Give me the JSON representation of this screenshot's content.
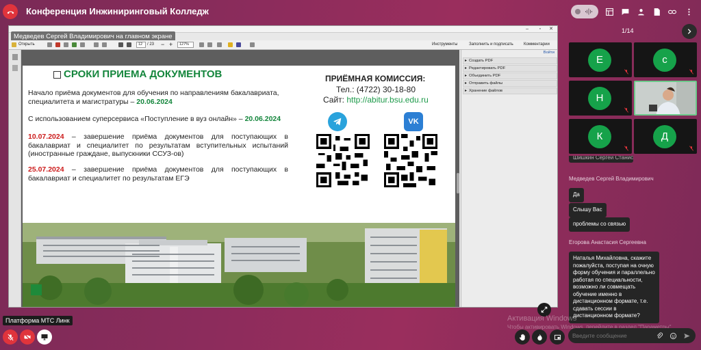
{
  "header": {
    "title": "Конференция Инжиниринговый Колледж",
    "icons": [
      "phone-hangup-icon",
      "noise-suppression-icon",
      "layout-icon",
      "chat-icon",
      "participants-icon",
      "file-icon",
      "link-icon",
      "more-icon"
    ]
  },
  "screen_share": {
    "presenter_label": "Медведев Сергей Владимирович на главном экране",
    "toolbar": {
      "open_label": "Открыть",
      "page_current": "12",
      "page_total": "/ 23",
      "zoom": "127%",
      "tools_label": "Инструменты",
      "sign_label": "Заполнить и подписать",
      "comment_label": "Комментарии"
    },
    "right_pane": {
      "login": "Войти",
      "items": [
        "Создать PDF",
        "Редактировать PDF",
        "Объединить PDF",
        "Отправить файлы",
        "Хранение файлов"
      ]
    },
    "slide": {
      "heading": "СРОКИ ПРИЕМА ДОКУМЕНТОВ",
      "p1_text": "Начало приёма документов для обучения по направлениям бакалавриата, специалитета и магистратуры – ",
      "p1_date": "20.06.2024",
      "p2_text": "С использованием суперсервиса «Поступление в вуз онлайн» – ",
      "p2_date": "20.06.2024",
      "p3_date": "10.07.2024",
      "p3_text": " – завершение приёма документов для поступающих в бакалавриат и специалитет по результатам вступительных испытаний (иностранные граждане, выпускники ССУЗ-ов)",
      "p4_date": "25.07.2024",
      "p4_text": " – завершение приёма документов для поступающих в бакалавриат и специалитет по результатам ЕГЭ",
      "commission_title": "ПРИЁМНАЯ КОМИССИЯ:",
      "commission_tel": "Тел.: (4722) 30-18-80",
      "commission_site_label": "Сайт: ",
      "commission_site": "http://abitur.bsu.edu.ru",
      "social": [
        "telegram-icon",
        "vk-icon"
      ]
    }
  },
  "participants": {
    "page": "1/14",
    "tiles": [
      {
        "initial": "Е",
        "muted": true
      },
      {
        "initial": "с",
        "muted": true
      },
      {
        "initial": "Н",
        "muted": true
      },
      {
        "initial": "",
        "muted": false,
        "video": true
      },
      {
        "initial": "К",
        "muted": true
      },
      {
        "initial": "Д",
        "muted": true
      }
    ]
  },
  "chat": {
    "partial_name": "Шишкин Сергей Станиславович",
    "messages": [
      {
        "author": "Медведев Сергей Владимирович",
        "texts": [
          "Да",
          "Слышу Вас",
          "проблемы со связью"
        ]
      },
      {
        "author": "Егорова Анастасия Сергеевна",
        "texts": [
          "Наталья Михайловна, скажите пожалуйста, поступая на очную форму обучения и параллельно работая по специальности, возможно ли совмещать обучение именно в дистанционном формате, т.е. сдавать сессии в дистанционном формате?"
        ]
      }
    ],
    "input_placeholder": "Введите сообщение"
  },
  "footer": {
    "platform_label": "Платформа МТС Линк",
    "watermark_title": "Активация Windows",
    "watermark_text": "Чтобы активировать Windows, перейдите в раздел \"Параметры\"."
  },
  "colors": {
    "accent_green": "#14863c",
    "danger_red": "#e0343c",
    "avatar_green": "#16a24a"
  }
}
